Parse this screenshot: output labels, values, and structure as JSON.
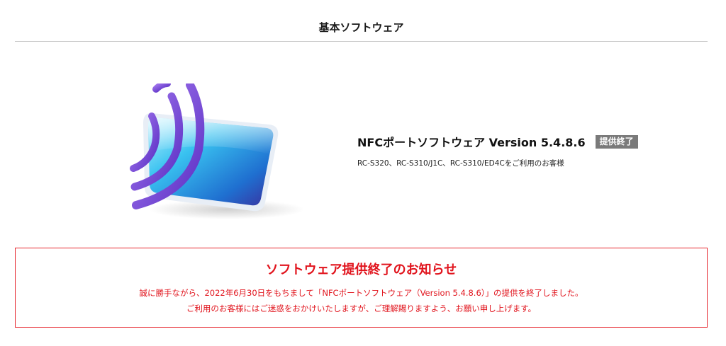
{
  "section": {
    "title": "基本ソフトウェア"
  },
  "product": {
    "image_icon": "nfc-card-wireless-icon",
    "name": "NFCポートソフトウェア Version 5.4.8.6",
    "badge": "提供終了",
    "description": "RC-S320、RC-S310/J1C、RC-S310/ED4Cをご利用のお客様"
  },
  "notice": {
    "title": "ソフトウェア提供終了のお知らせ",
    "lines": [
      "誠に勝手ながら、2022年6月30日をもちまして「NFCポートソフトウェア（Version 5.4.8.6）」の提供を終了しました。",
      "ご利用のお客様にはご迷惑をおかけいたしますが、ご理解賜りますよう、お願い申し上げます。"
    ]
  },
  "colors": {
    "notice_red": "#e1141d",
    "badge_gray": "#7a7a7a",
    "divider": "#c8c8c8"
  }
}
